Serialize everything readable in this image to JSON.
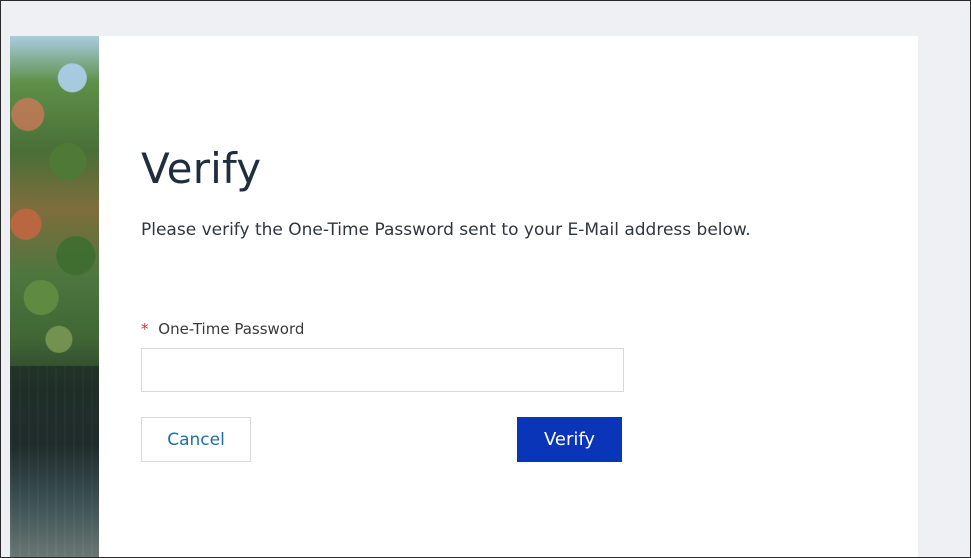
{
  "page": {
    "title": "Verify",
    "subtitle": "Please verify the One-Time Password sent to your E-Mail address below."
  },
  "otp_field": {
    "required_marker": "*",
    "label": "One-Time Password",
    "value": "",
    "placeholder": ""
  },
  "actions": {
    "cancel_label": "Cancel",
    "verify_label": "Verify"
  },
  "colors": {
    "background": "#eef0f3",
    "card": "#ffffff",
    "title_text": "#1f2d3d",
    "body_text": "#2f3640",
    "required": "#c23934",
    "link_blue": "#1b6fa8",
    "primary_button": "#0a35b8"
  }
}
